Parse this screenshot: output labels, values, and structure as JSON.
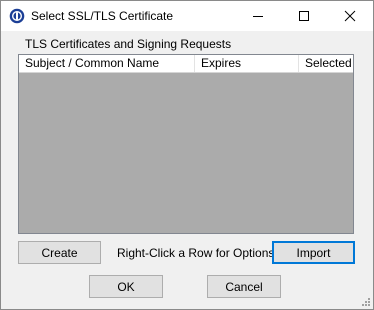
{
  "window": {
    "title": "Select SSL/TLS Certificate",
    "icon": "app-icon",
    "controls": {
      "minimize": "minimize-icon",
      "maximize": "maximize-icon",
      "close": "close-icon"
    }
  },
  "group": {
    "label": "TLS Certificates and Signing Requests"
  },
  "table": {
    "columns": [
      "Subject / Common Name",
      "Expires",
      "Selected"
    ],
    "rows": []
  },
  "actions": {
    "create_label": "Create",
    "hint": "Right-Click a Row for Options",
    "import_label": "Import"
  },
  "dialog": {
    "ok_label": "OK",
    "cancel_label": "Cancel"
  },
  "colors": {
    "list_background": "#ababab",
    "focus_border": "#0078d7"
  }
}
